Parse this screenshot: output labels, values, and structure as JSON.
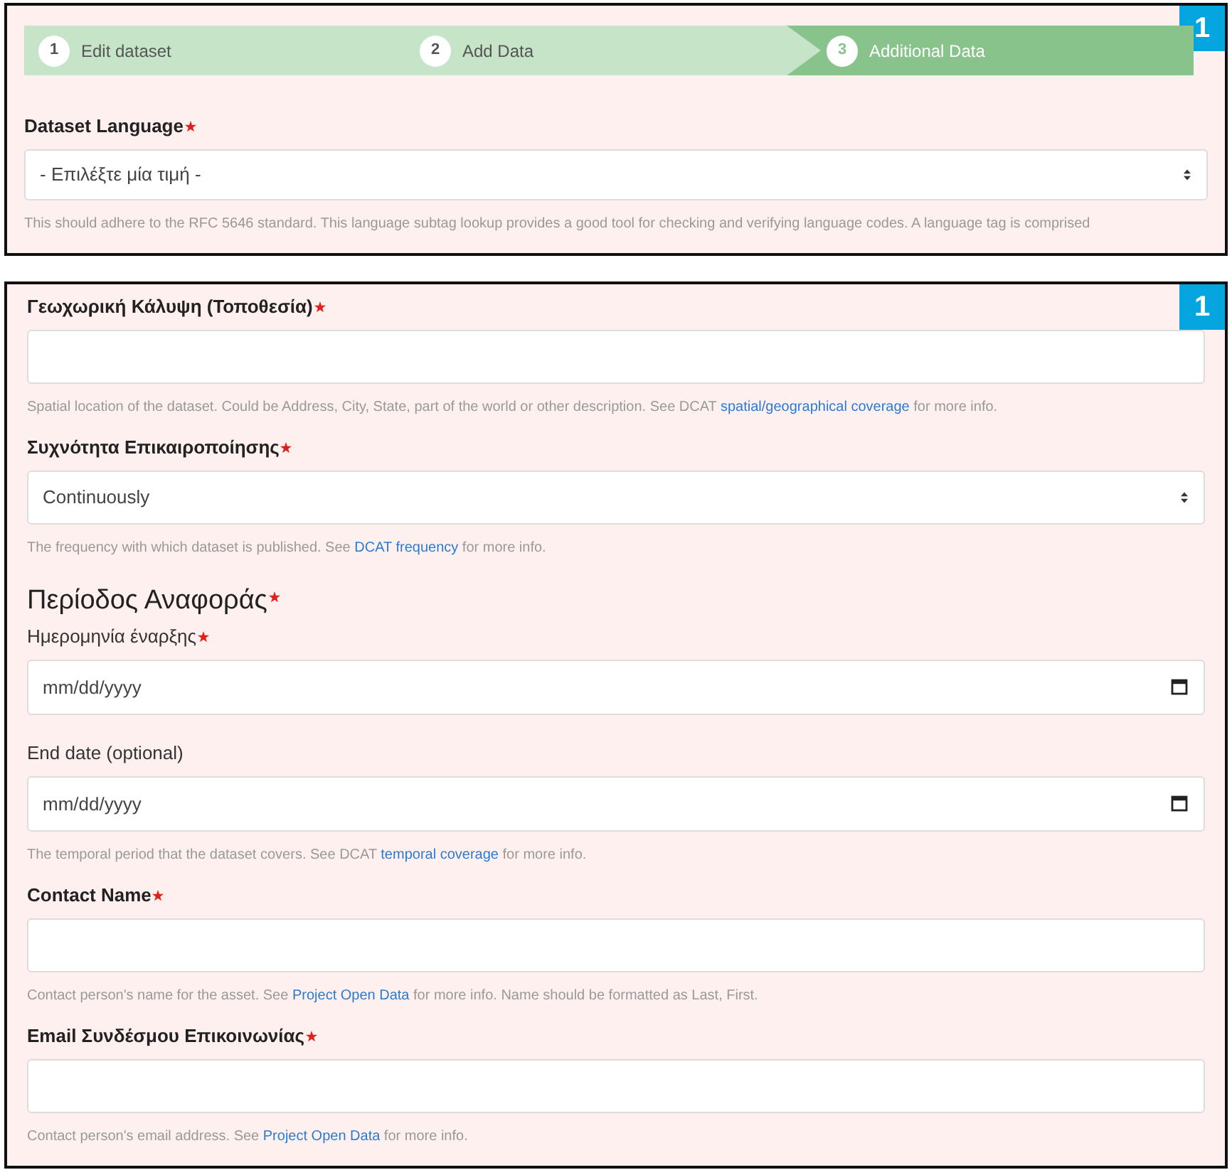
{
  "panels": [
    {
      "badge": "1",
      "steps": [
        {
          "number": "1",
          "label": "Edit dataset",
          "selected": false
        },
        {
          "number": "2",
          "label": "Add Data",
          "selected": false
        },
        {
          "number": "3",
          "label": "Additional Data",
          "selected": true
        }
      ],
      "fields": [
        {
          "kind": "select",
          "label": "Dataset Language",
          "required": true,
          "value": "- Επιλέξτε μία τιμή -",
          "help": {
            "before": "This should adhere to the RFC 5646 standard. This language subtag lookup provides a good tool for checking and verifying language codes. A language tag is comprised"
          }
        }
      ]
    },
    {
      "badge": "1",
      "fields": [
        {
          "kind": "text",
          "label": "Γεωχωρική Κάλυψη (Τοποθεσία)",
          "required": true,
          "help": {
            "before": "Spatial location of the dataset. Could be Address, City, State, part of the world or other description. See DCAT ",
            "link": "spatial/geographical coverage",
            "after": " for more info."
          }
        },
        {
          "kind": "select",
          "label": "Συχνότητα Επικαιροποίησης",
          "required": true,
          "value": "Continuously",
          "help": {
            "before": "The frequency with which dataset is published. See ",
            "link": "DCAT frequency",
            "after": " for more info."
          }
        },
        {
          "kind": "heading",
          "label": "Περίοδος Αναφοράς",
          "required": true
        },
        {
          "kind": "date",
          "label": "Ημερομηνία έναρξης",
          "required": true,
          "placeholder": "mm/dd/yyyy"
        },
        {
          "kind": "date",
          "label": "End date (optional)",
          "required": false,
          "placeholder": "mm/dd/yyyy",
          "help": {
            "before": "The temporal period that the dataset covers. See DCAT ",
            "link": "temporal coverage",
            "after": " for more info."
          }
        },
        {
          "kind": "text",
          "label": "Contact Name",
          "required": true,
          "help": {
            "before": "Contact person's name for the asset. See ",
            "link": "Project Open Data",
            "after": " for more info. Name should be formatted as Last, First."
          }
        },
        {
          "kind": "text",
          "label": "Email Συνδέσμου Επικοινωνίας",
          "required": true,
          "help": {
            "before": "Contact person's email address. See ",
            "link": "Project Open Data",
            "after": " for more info."
          }
        }
      ]
    }
  ]
}
